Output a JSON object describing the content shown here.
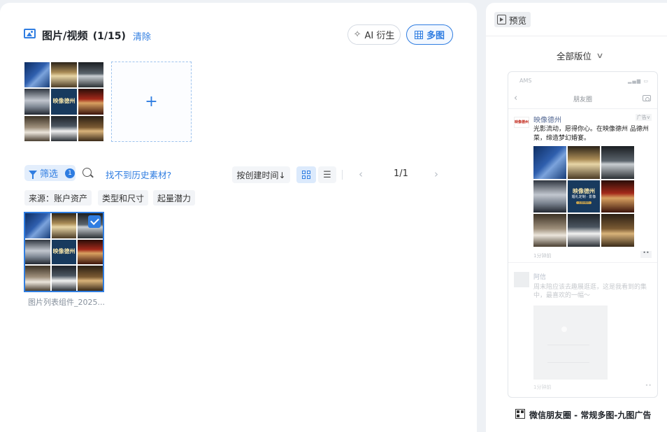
{
  "header": {
    "title": "图片/视频",
    "count": "(1/15)",
    "clear_label": "清除",
    "ai_label": "AI 衍生",
    "multi_label": "多图"
  },
  "upload": {
    "add_symbol": "+"
  },
  "toolbar": {
    "filter_label": "筛选",
    "filter_count": "1",
    "history_link": "找不到历史素材?",
    "sort_label": "按创建时间↓",
    "page_prev": "‹",
    "page_info": "1/1",
    "page_next": "›"
  },
  "filters": [
    "来源：账户资产",
    "类型和尺寸",
    "起量潜力"
  ],
  "asset": {
    "name": "图片列表组件_2025..."
  },
  "poster": {
    "title": "映像德州",
    "subtitle": "婚礼定制 · 影像",
    "button": "立即预约"
  },
  "preview": {
    "tab_label": "预览",
    "placement_label": "全部版位",
    "footer_label": "微信朋友圈 - 常规多图-九图广告"
  },
  "phone": {
    "status": "AMS",
    "signal": "▂▄▆ ▭",
    "nav_title": "朋友圈",
    "ad_avatar": "映像德州",
    "ad_name": "映像德州",
    "ad_tag": "广告∨",
    "ad_text": "光影流动，愿得你心。在映像德州 品德州菜，缔造梦幻婚宴。",
    "ad_time": "1分钟前",
    "ad_more": "••",
    "friend_name": "阿信",
    "friend_text": "周末陪应该去趣展逛逛，这是我看到的集中，最喜欢的一幅～",
    "friend_time": "1分钟前",
    "friend_more": "••"
  }
}
